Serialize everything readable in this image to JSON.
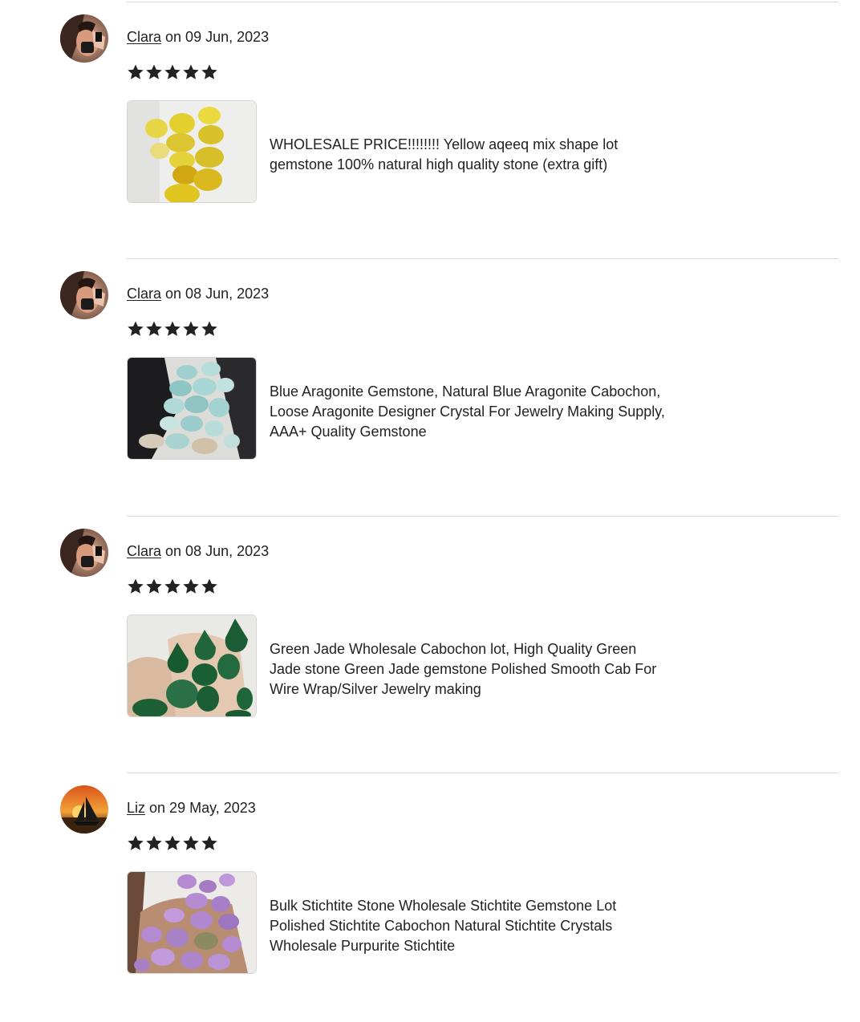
{
  "reviews": [
    {
      "reviewer": "Clara",
      "date_text": "on 09 Jun, 2023",
      "rating": 5,
      "avatar_icon": "reviewer-photo-clara",
      "thumbnail_icon": "yellow-aqeeq-gemstones-photo",
      "product_title": "WHOLESALE PRICE!!!!!!!! Yellow aqeeq mix shape lot gemstone 100% natural high quality stone (extra gift)"
    },
    {
      "reviewer": "Clara",
      "date_text": "on 08 Jun, 2023",
      "rating": 5,
      "avatar_icon": "reviewer-photo-clara",
      "thumbnail_icon": "blue-aragonite-gemstones-photo",
      "product_title": "Blue Aragonite Gemstone, Natural Blue Aragonite Cabochon, Loose Aragonite Designer Crystal For Jewelry Making Supply, AAA+ Quality Gemstone"
    },
    {
      "reviewer": "Clara",
      "date_text": "on 08 Jun, 2023",
      "rating": 5,
      "avatar_icon": "reviewer-photo-clara",
      "thumbnail_icon": "green-jade-cabochons-photo",
      "product_title": "Green Jade Wholesale Cabochon lot, High Quality Green Jade stone Green Jade gemstone Polished Smooth Cab For Wire Wrap/Silver Jewelry making"
    },
    {
      "reviewer": "Liz",
      "date_text": "on 29 May, 2023",
      "rating": 5,
      "avatar_icon": "sunset-sailboat-avatar",
      "thumbnail_icon": "purple-stichtite-stones-photo",
      "product_title": "Bulk Stichtite Stone Wholesale Stichtite Gemstone Lot Polished Stichtite Cabochon Natural Stichtite Crystals Wholesale Purpurite Stichtite"
    }
  ],
  "colors": {
    "text": "#222222",
    "divider": "#d8d8d8",
    "star": "#222222"
  }
}
